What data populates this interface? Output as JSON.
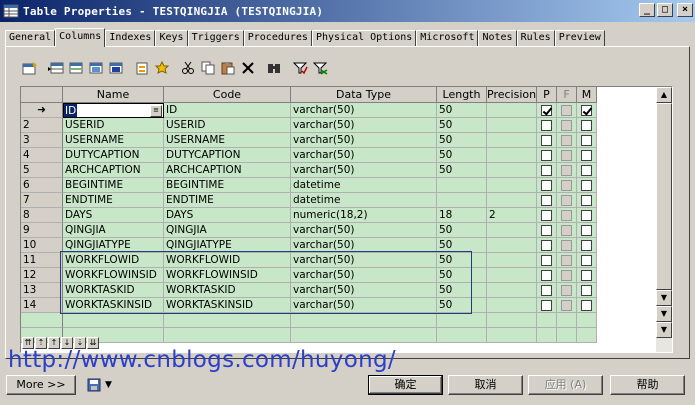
{
  "window": {
    "title": "Table Properties - TESTQINGJIA (TESTQINGJIA)",
    "minimize": "_",
    "maximize": "□",
    "close": "×"
  },
  "tabs": [
    {
      "label": "General"
    },
    {
      "label": "Columns"
    },
    {
      "label": "Indexes"
    },
    {
      "label": "Keys"
    },
    {
      "label": "Triggers"
    },
    {
      "label": "Procedures"
    },
    {
      "label": "Physical Options"
    },
    {
      "label": "Microsoft"
    },
    {
      "label": "Notes"
    },
    {
      "label": "Rules"
    },
    {
      "label": "Preview"
    }
  ],
  "active_tab": "Columns",
  "toolbar_icons": [
    "properties-icon",
    "add-row-icon",
    "insert-row-icon",
    "add-rows-icon",
    "delete-rows-icon",
    "new-icon",
    "add-attribute-icon",
    "cut-icon",
    "copy-icon",
    "paste-icon",
    "delete-icon",
    "find-icon",
    "filter-icon",
    "clear-filter-icon"
  ],
  "grid": {
    "headers": {
      "name": "Name",
      "code": "Code",
      "type": "Data Type",
      "length": "Length",
      "precision": "Precision",
      "p": "P",
      "f": "F",
      "m": "M"
    },
    "current_marker": "➜",
    "dropdown_glyph": "≡",
    "rows": [
      {
        "num": "",
        "name": "ID",
        "code": "ID",
        "type": "varchar(50)",
        "length": "50",
        "precision": "",
        "p": true,
        "f": false,
        "m": true
      },
      {
        "num": "2",
        "name": "USERID",
        "code": "USERID",
        "type": "varchar(50)",
        "length": "50",
        "precision": "",
        "p": false,
        "f": false,
        "m": false
      },
      {
        "num": "3",
        "name": "USERNAME",
        "code": "USERNAME",
        "type": "varchar(50)",
        "length": "50",
        "precision": "",
        "p": false,
        "f": false,
        "m": false
      },
      {
        "num": "4",
        "name": "DUTYCAPTION",
        "code": "DUTYCAPTION",
        "type": "varchar(50)",
        "length": "50",
        "precision": "",
        "p": false,
        "f": false,
        "m": false
      },
      {
        "num": "5",
        "name": "ARCHCAPTION",
        "code": "ARCHCAPTION",
        "type": "varchar(50)",
        "length": "50",
        "precision": "",
        "p": false,
        "f": false,
        "m": false
      },
      {
        "num": "6",
        "name": "BEGINTIME",
        "code": "BEGINTIME",
        "type": "datetime",
        "length": "",
        "precision": "",
        "p": false,
        "f": false,
        "m": false
      },
      {
        "num": "7",
        "name": "ENDTIME",
        "code": "ENDTIME",
        "type": "datetime",
        "length": "",
        "precision": "",
        "p": false,
        "f": false,
        "m": false
      },
      {
        "num": "8",
        "name": "DAYS",
        "code": "DAYS",
        "type": "numeric(18,2)",
        "length": "18",
        "precision": "2",
        "p": false,
        "f": false,
        "m": false
      },
      {
        "num": "9",
        "name": "QINGJIA",
        "code": "QINGJIA",
        "type": "varchar(50)",
        "length": "50",
        "precision": "",
        "p": false,
        "f": false,
        "m": false
      },
      {
        "num": "10",
        "name": "QINGJIATYPE",
        "code": "QINGJIATYPE",
        "type": "varchar(50)",
        "length": "50",
        "precision": "",
        "p": false,
        "f": false,
        "m": false
      },
      {
        "num": "11",
        "name": "WORKFLOWID",
        "code": "WORKFLOWID",
        "type": "varchar(50)",
        "length": "50",
        "precision": "",
        "p": false,
        "f": false,
        "m": false
      },
      {
        "num": "12",
        "name": "WORKFLOWINSID",
        "code": "WORKFLOWINSID",
        "type": "varchar(50)",
        "length": "50",
        "precision": "",
        "p": false,
        "f": false,
        "m": false
      },
      {
        "num": "13",
        "name": "WORKTASKID",
        "code": "WORKTASKID",
        "type": "varchar(50)",
        "length": "50",
        "precision": "",
        "p": false,
        "f": false,
        "m": false
      },
      {
        "num": "14",
        "name": "WORKTASKINSID",
        "code": "WORKTASKINSID",
        "type": "varchar(50)",
        "length": "50",
        "precision": "",
        "p": false,
        "f": false,
        "m": false
      }
    ]
  },
  "nav_buttons": [
    "⇈",
    "⇡",
    "↑",
    "↓",
    "⇣",
    "⇊"
  ],
  "watermark": "http://www.cnblogs.com/huyong/",
  "buttons": {
    "more": "More >>",
    "ok": "确定",
    "cancel": "取消",
    "apply": "应用 (A)",
    "help": "帮助"
  },
  "colors": {
    "grid_row": "#c8e6c8",
    "highlight": "#1f3f7a",
    "title_start": "#0a246a"
  }
}
